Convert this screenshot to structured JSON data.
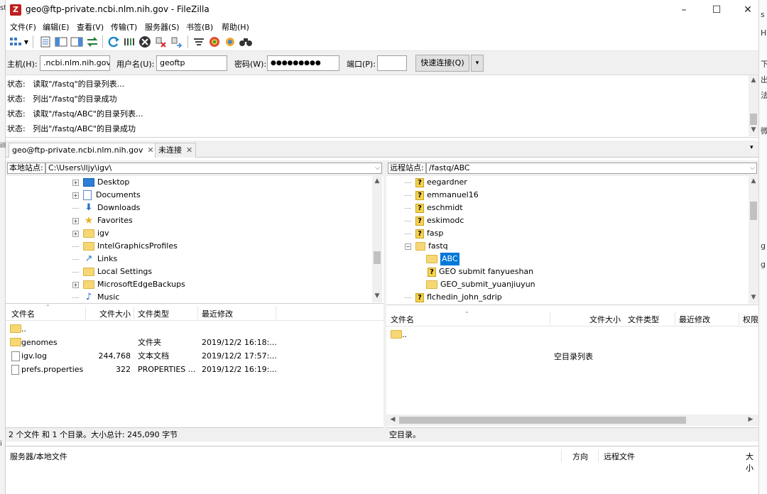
{
  "window": {
    "title": "geo@ftp-private.ncbi.nlm.nih.gov - FileZilla",
    "app_icon": "Z",
    "controls": [
      "–",
      "☐",
      "✕"
    ]
  },
  "menu": [
    "文件(F)",
    "编辑(E)",
    "查看(V)",
    "传输(T)",
    "服务器(S)",
    "书签(B)",
    "帮助(H)"
  ],
  "toolbar": {
    "icons": [
      "site-manager-icon",
      "dropdown-icon",
      "toggle-log-icon",
      "toggle-local-tree-icon",
      "toggle-remote-tree-icon",
      "toggle-queue-icon",
      "refresh-icon",
      "process-queue-icon",
      "cancel-icon",
      "disconnect-icon",
      "reconnect-icon",
      "filter-icon",
      "compare-icon",
      "sync-browse-icon",
      "search-icon"
    ]
  },
  "quickconnect": {
    "host_label": "主机(H):",
    "host_value": ".ncbi.nlm.nih.gov",
    "user_label": "用户名(U):",
    "user_value": "geoftp",
    "pass_label": "密码(W):",
    "pass_value": "●●●●●●●●●",
    "port_label": "端口(P):",
    "port_value": "",
    "connect_label": "快速连接(Q)",
    "dropdown_glyph": "▾"
  },
  "log": [
    {
      "label": "状态:",
      "text": "读取\"/fastq\"的目录列表..."
    },
    {
      "label": "状态:",
      "text": "列出\"/fastq\"的目录成功"
    },
    {
      "label": "状态:",
      "text": "读取\"/fastq/ABC\"的目录列表..."
    },
    {
      "label": "状态:",
      "text": "列出\"/fastq/ABC\"的目录成功"
    }
  ],
  "tabs": [
    {
      "label": "geo@ftp-private.ncbi.nlm.nih.gov",
      "close": "✕"
    },
    {
      "label": "未连接",
      "close": "✕"
    }
  ],
  "tab_menu_glyph": "▾",
  "local": {
    "site_label": "本地站点:",
    "path": "C:\\Users\\lljy\\igv\\",
    "tree": [
      {
        "label": "Desktop",
        "icon": "desktop-icon",
        "expandable": true
      },
      {
        "label": "Documents",
        "icon": "documents-icon",
        "expandable": true
      },
      {
        "label": "Downloads",
        "icon": "downloads-icon",
        "expandable": false
      },
      {
        "label": "Favorites",
        "icon": "favorites-icon",
        "expandable": true
      },
      {
        "label": "igv",
        "icon": "folder-icon",
        "expandable": true
      },
      {
        "label": "IntelGraphicsProfiles",
        "icon": "folder-icon",
        "expandable": false
      },
      {
        "label": "Links",
        "icon": "links-icon",
        "expandable": false
      },
      {
        "label": "Local Settings",
        "icon": "folder-icon",
        "expandable": false
      },
      {
        "label": "MicrosoftEdgeBackups",
        "icon": "folder-icon",
        "expandable": true
      },
      {
        "label": "Music",
        "icon": "music-icon",
        "expandable": false
      }
    ],
    "columns": [
      "文件名",
      "文件大小",
      "文件类型",
      "最近修改"
    ],
    "files": [
      {
        "name": "..",
        "size": "",
        "type": "",
        "modified": "",
        "icon": "folder-icon"
      },
      {
        "name": "genomes",
        "size": "",
        "type": "文件夹",
        "modified": "2019/12/2 16:18:...",
        "icon": "folder-icon"
      },
      {
        "name": "igv.log",
        "size": "244,768",
        "type": "文本文档",
        "modified": "2019/12/2 17:57:...",
        "icon": "text-file-icon"
      },
      {
        "name": "prefs.properties",
        "size": "322",
        "type": "PROPERTIES ...",
        "modified": "2019/12/2 16:19:...",
        "icon": "file-icon"
      }
    ],
    "status": "2 个文件 和 1 个目录。大小总计: 245,090 字节"
  },
  "remote": {
    "site_label": "远程站点:",
    "path": "/fastq/ABC",
    "tree": [
      {
        "label": "eegardner",
        "icon": "unknown-folder-icon",
        "indent": 0,
        "expandable": false
      },
      {
        "label": "emmanuel16",
        "icon": "unknown-folder-icon",
        "indent": 0,
        "expandable": false
      },
      {
        "label": "eschmidt",
        "icon": "unknown-folder-icon",
        "indent": 0,
        "expandable": false
      },
      {
        "label": "eskimodc",
        "icon": "unknown-folder-icon",
        "indent": 0,
        "expandable": false
      },
      {
        "label": "fasp",
        "icon": "unknown-folder-icon",
        "indent": 0,
        "expandable": false
      },
      {
        "label": "fastq",
        "icon": "open-folder-icon",
        "indent": 0,
        "expandable": true
      },
      {
        "label": "ABC",
        "icon": "folder-icon",
        "indent": 1,
        "expandable": false,
        "selected": true
      },
      {
        "label": "GEO submit fanyueshan",
        "icon": "unknown-folder-icon",
        "indent": 1,
        "expandable": false
      },
      {
        "label": "GEO_submit_yuanjiuyun",
        "icon": "folder-icon",
        "indent": 1,
        "expandable": false
      },
      {
        "label": "flchedin_john_sdrip",
        "icon": "unknown-folder-icon",
        "indent": 0,
        "expandable": false
      }
    ],
    "columns": [
      "文件名",
      "文件大小",
      "文件类型",
      "最近修改",
      "权限"
    ],
    "files": [
      {
        "name": "..",
        "icon": "folder-icon"
      }
    ],
    "empty_text": "空目录列表",
    "status": "空目录。"
  },
  "queue": {
    "columns": [
      "服务器/本地文件",
      "方向",
      "远程文件",
      "大小"
    ]
  },
  "background": {
    "left_chars": [
      "st",
      "ill",
      "i"
    ],
    "right_chars": [
      "s",
      "H",
      "下",
      "出",
      "法",
      "微",
      "g",
      "g"
    ]
  }
}
